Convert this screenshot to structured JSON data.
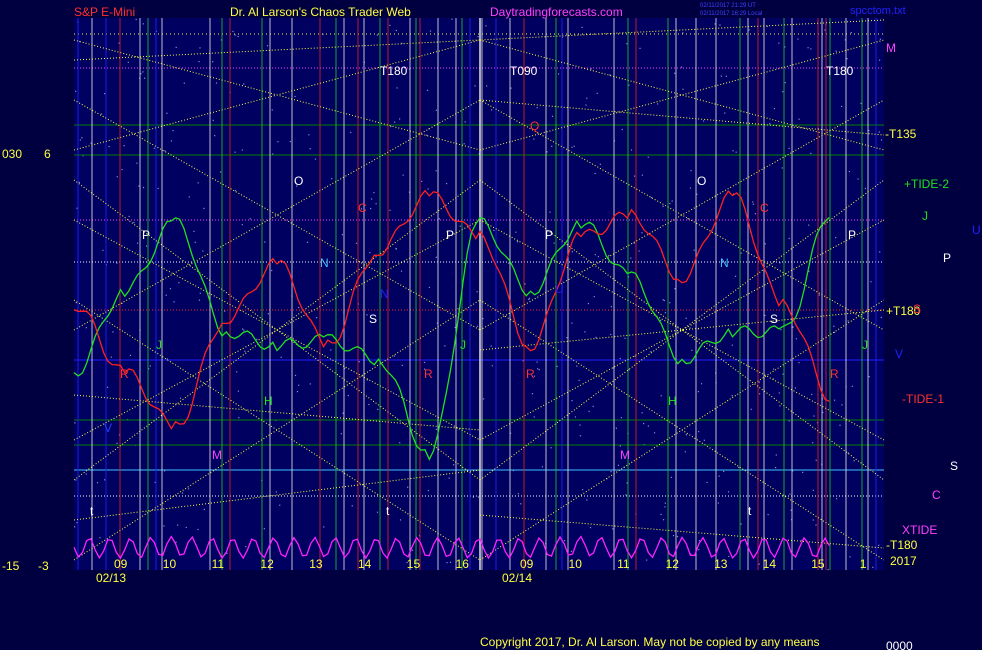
{
  "header": {
    "symbol": "S&P E-Mini",
    "author": "Dr. Al Larson's Chaos Trader Web",
    "site": "Daytradingforecasts.com",
    "time_utc": "02/11/2017 21:29 UT",
    "time_local": "02/11/2017 16:29 Local",
    "file": "spcctom.txt"
  },
  "left_axis": {
    "top_a": "030",
    "top_b": "6",
    "bottom_a": "-15",
    "bottom_b": "-3"
  },
  "panels": [
    {
      "date": "02/13",
      "hours": [
        "09",
        "10",
        "11",
        "12",
        "13",
        "14",
        "15",
        "16"
      ]
    },
    {
      "date": "02/14",
      "hours": [
        "09",
        "10",
        "11",
        "12",
        "13",
        "14",
        "15",
        "1"
      ]
    }
  ],
  "right_labels": {
    "m": "M",
    "t135": "-T135",
    "tide2": "+TIDE-2",
    "j": "J",
    "u": "U",
    "p": "P",
    "t180p": "+T180",
    "s": "S",
    "v": "V",
    "tide1": "-TIDE-1",
    "s2": "S",
    "c": "C",
    "xtide": "XTIDE",
    "t180m": "-T180",
    "year": "2017"
  },
  "chart_labels": {
    "t180a": "T180",
    "t090": "T090",
    "t180b": "T180",
    "o1": "O",
    "o2": "O",
    "p1": "P",
    "p2": "P",
    "p3": "P",
    "p4": "P",
    "n1": "N",
    "n2": "N",
    "s1": "S",
    "s2": "S",
    "j1": "J",
    "j2": "J",
    "j3": "J",
    "h1": "H",
    "h2": "H",
    "m1": "M",
    "m2": "M",
    "r1": "R",
    "r2": "R",
    "r3": "R",
    "r4": "R",
    "v1": "V",
    "t1": "t",
    "t2": "t",
    "t3": "t",
    "c1": "C",
    "c2": "C",
    "q1": "Q",
    "n3": "N",
    "u1": "U"
  },
  "copyright": "Copyright 2017, Dr. Al Larson. May not be copied by any means",
  "corner": "0000",
  "colors": {
    "background": "#000040",
    "plot": "#000060",
    "red": "#ff2020",
    "green": "#20e020",
    "magenta": "#ff20ff",
    "yellow": "#ffff40",
    "white": "#ffffff",
    "blue": "#2020ff"
  },
  "chart_data": {
    "type": "line",
    "title": "S&P E-Mini",
    "x": [
      "02/13 09",
      "02/13 10",
      "02/13 11",
      "02/13 12",
      "02/13 13",
      "02/13 14",
      "02/13 15",
      "02/13 16",
      "02/14 09",
      "02/14 10",
      "02/14 11",
      "02/14 12",
      "02/14 13",
      "02/14 14",
      "02/14 15",
      "02/14 16"
    ],
    "series": [
      {
        "name": "+TIDE-2",
        "color": "#20e020",
        "values": [
          -2,
          1,
          3.5,
          -0.5,
          -1,
          -0.8,
          -1.5,
          -5,
          3.5,
          1,
          3.5,
          1.5,
          -1.5,
          -0.5,
          -0.5,
          4
        ]
      },
      {
        "name": "-TIDE-1",
        "color": "#ff2020",
        "values": [
          0.5,
          -2,
          -4,
          0,
          2,
          -1,
          2.5,
          4.5,
          3,
          -1,
          3,
          3.8,
          1.5,
          4.5,
          0.5,
          -3
        ]
      },
      {
        "name": "XTIDE",
        "color": "#ff20ff",
        "values": [
          -12,
          -13,
          -11,
          -13,
          -12.5,
          -12,
          -13,
          -12,
          -13,
          -12.5,
          -11,
          -12.5,
          -12,
          -13,
          -12,
          -13
        ]
      }
    ],
    "ylim": [
      -3,
      6
    ],
    "xtide_ylim": [
      -15,
      30
    ]
  }
}
